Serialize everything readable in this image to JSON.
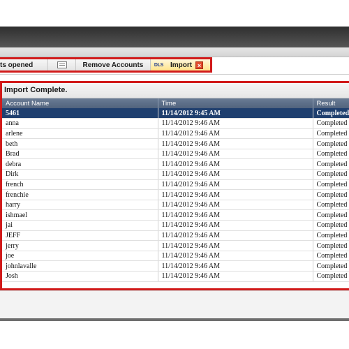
{
  "tabs": [
    {
      "label": "ts opened"
    },
    {
      "label": ""
    },
    {
      "label": "Remove Accounts"
    },
    {
      "label": "Import",
      "icon_text": "DLS"
    }
  ],
  "panel": {
    "title": "Import Complete."
  },
  "table": {
    "columns": [
      "Account Name",
      "Time",
      "Result"
    ],
    "rows": [
      {
        "account": "5461",
        "time": "11/14/2012 9:45 AM",
        "result": "Completed"
      },
      {
        "account": "anna",
        "time": "11/14/2012 9:46 AM",
        "result": "Completed"
      },
      {
        "account": "arlene",
        "time": "11/14/2012 9:46 AM",
        "result": "Completed"
      },
      {
        "account": "beth",
        "time": "11/14/2012 9:46 AM",
        "result": "Completed"
      },
      {
        "account": "Brad",
        "time": "11/14/2012 9:46 AM",
        "result": "Completed"
      },
      {
        "account": "debra",
        "time": "11/14/2012 9:46 AM",
        "result": "Completed"
      },
      {
        "account": "Dirk",
        "time": "11/14/2012 9:46 AM",
        "result": "Completed"
      },
      {
        "account": "french",
        "time": "11/14/2012 9:46 AM",
        "result": "Completed"
      },
      {
        "account": "frenchie",
        "time": "11/14/2012 9:46 AM",
        "result": "Completed"
      },
      {
        "account": "harry",
        "time": "11/14/2012 9:46 AM",
        "result": "Completed"
      },
      {
        "account": "ishmael",
        "time": "11/14/2012 9:46 AM",
        "result": "Completed"
      },
      {
        "account": "jai",
        "time": "11/14/2012 9:46 AM",
        "result": "Completed"
      },
      {
        "account": "JEFF",
        "time": "11/14/2012 9:46 AM",
        "result": "Completed"
      },
      {
        "account": "jerry",
        "time": "11/14/2012 9:46 AM",
        "result": "Completed"
      },
      {
        "account": "joe",
        "time": "11/14/2012 9:46 AM",
        "result": "Completed"
      },
      {
        "account": "johnlavalle",
        "time": "11/14/2012 9:46 AM",
        "result": "Completed"
      },
      {
        "account": "Josh",
        "time": "11/14/2012 9:46 AM",
        "result": "Completed"
      }
    ]
  },
  "colors": {
    "highlight_border": "#d11a1a",
    "selected_row": "#1f3f6e",
    "header_bg": "#5a6c86"
  }
}
